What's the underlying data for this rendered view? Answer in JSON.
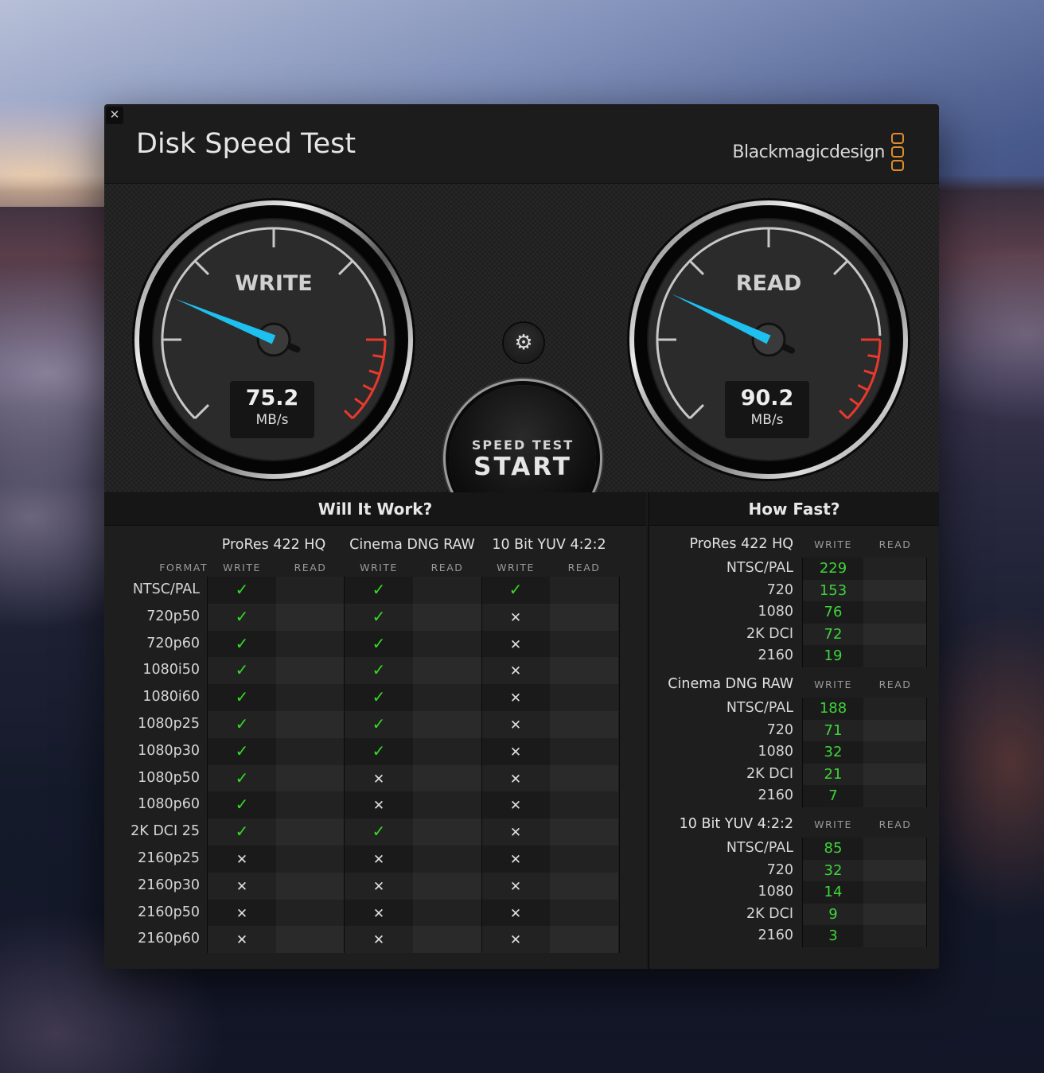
{
  "window": {
    "title": "Disk Speed Test",
    "close_icon": "close-icon",
    "brand": "Blackmagicdesign",
    "brand_accent": "#e08c2a"
  },
  "gauges": {
    "scale_max_fraction_note": "needle fraction of sweep",
    "write": {
      "label": "WRITE",
      "value": "75.2",
      "unit": "MB/s",
      "needle_fraction": 0.25
    },
    "read": {
      "label": "READ",
      "value": "90.2",
      "unit": "MB/s",
      "needle_fraction": 0.26
    },
    "needle_color": "#1ec0f0",
    "redline_color": "#e8392c"
  },
  "controls": {
    "settings_icon": "gear-icon",
    "start_sub": "SPEED TEST",
    "start_main": "START"
  },
  "will_it_work": {
    "title": "Will It Work?",
    "format_header": "FORMAT",
    "codecs": [
      "ProRes 422 HQ",
      "Cinema DNG RAW",
      "10 Bit YUV 4:2:2"
    ],
    "write_header": "WRITE",
    "read_header": "READ",
    "rows": [
      {
        "format": "NTSC/PAL",
        "prores_write": true,
        "dng_write": true,
        "yuv_write": true
      },
      {
        "format": "720p50",
        "prores_write": true,
        "dng_write": true,
        "yuv_write": false
      },
      {
        "format": "720p60",
        "prores_write": true,
        "dng_write": true,
        "yuv_write": false
      },
      {
        "format": "1080i50",
        "prores_write": true,
        "dng_write": true,
        "yuv_write": false
      },
      {
        "format": "1080i60",
        "prores_write": true,
        "dng_write": true,
        "yuv_write": false
      },
      {
        "format": "1080p25",
        "prores_write": true,
        "dng_write": true,
        "yuv_write": false
      },
      {
        "format": "1080p30",
        "prores_write": true,
        "dng_write": true,
        "yuv_write": false
      },
      {
        "format": "1080p50",
        "prores_write": true,
        "dng_write": false,
        "yuv_write": false
      },
      {
        "format": "1080p60",
        "prores_write": true,
        "dng_write": false,
        "yuv_write": false
      },
      {
        "format": "2K DCI 25",
        "prores_write": true,
        "dng_write": true,
        "yuv_write": false
      },
      {
        "format": "2160p25",
        "prores_write": false,
        "dng_write": false,
        "yuv_write": false
      },
      {
        "format": "2160p30",
        "prores_write": false,
        "dng_write": false,
        "yuv_write": false
      },
      {
        "format": "2160p50",
        "prores_write": false,
        "dng_write": false,
        "yuv_write": false
      },
      {
        "format": "2160p60",
        "prores_write": false,
        "dng_write": false,
        "yuv_write": false
      }
    ],
    "ok_glyph": "✓",
    "no_glyph": "✕"
  },
  "how_fast": {
    "title": "How Fast?",
    "write_header": "WRITE",
    "read_header": "READ",
    "groups": [
      {
        "codec": "ProRes 422 HQ",
        "rows": [
          {
            "label": "NTSC/PAL",
            "write": "229",
            "read": ""
          },
          {
            "label": "720",
            "write": "153",
            "read": ""
          },
          {
            "label": "1080",
            "write": "76",
            "read": ""
          },
          {
            "label": "2K DCI",
            "write": "72",
            "read": ""
          },
          {
            "label": "2160",
            "write": "19",
            "read": ""
          }
        ]
      },
      {
        "codec": "Cinema DNG RAW",
        "rows": [
          {
            "label": "NTSC/PAL",
            "write": "188",
            "read": ""
          },
          {
            "label": "720",
            "write": "71",
            "read": ""
          },
          {
            "label": "1080",
            "write": "32",
            "read": ""
          },
          {
            "label": "2K DCI",
            "write": "21",
            "read": ""
          },
          {
            "label": "2160",
            "write": "7",
            "read": ""
          }
        ]
      },
      {
        "codec": "10 Bit YUV 4:2:2",
        "rows": [
          {
            "label": "NTSC/PAL",
            "write": "85",
            "read": ""
          },
          {
            "label": "720",
            "write": "32",
            "read": ""
          },
          {
            "label": "1080",
            "write": "14",
            "read": ""
          },
          {
            "label": "2K DCI",
            "write": "9",
            "read": ""
          },
          {
            "label": "2160",
            "write": "3",
            "read": ""
          }
        ]
      }
    ]
  }
}
